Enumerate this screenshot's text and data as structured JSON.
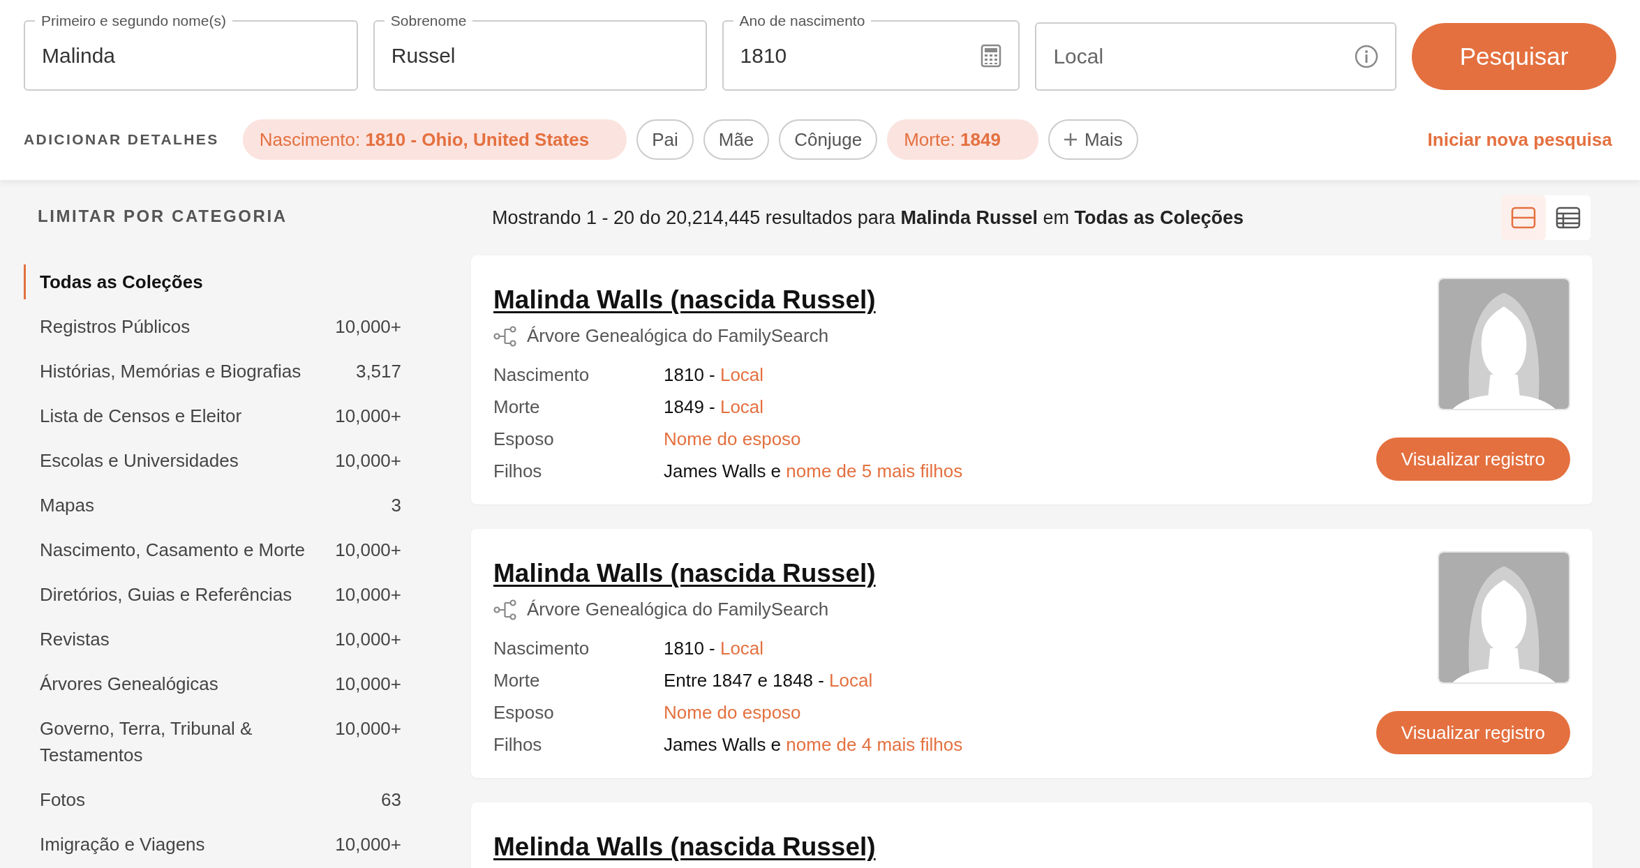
{
  "search": {
    "fields": [
      {
        "kind": "text",
        "label": "Primeiro e segundo nome(s)",
        "value": "Malinda"
      },
      {
        "kind": "text",
        "label": "Sobrenome",
        "value": "Russel"
      },
      {
        "kind": "date",
        "label": "Ano de nascimento",
        "value": "1810"
      },
      {
        "kind": "place",
        "placeholder": "Local"
      }
    ],
    "button": "Pesquisar"
  },
  "details": {
    "label": "ADICIONAR DETALHES",
    "chips": [
      {
        "kind": "filter",
        "text": "Nascimento: **1810 - Ohio, United States**",
        "active": true
      },
      {
        "kind": "filter",
        "text": "Pai",
        "active": false
      },
      {
        "kind": "filter",
        "text": "Mãe",
        "active": false
      },
      {
        "kind": "filter",
        "text": "Cônjuge",
        "active": false
      },
      {
        "kind": "filter",
        "text": "Morte: **1849**",
        "active": true
      },
      {
        "kind": "add",
        "text": "Mais",
        "active": false
      }
    ],
    "new_search": "Iniciar nova pesquisa"
  },
  "sidebar": {
    "heading": "LIMITAR POR CATEGORIA",
    "items": [
      {
        "label": "Todas as Coleções",
        "selected": true
      },
      {
        "label": "Registros Públicos",
        "count": "10,000+",
        "selected": false
      },
      {
        "label": "Histórias, Memórias e Biografias",
        "count": "3,517",
        "selected": false
      },
      {
        "label": "Lista de Censos e Eleitor",
        "count": "10,000+",
        "selected": false
      },
      {
        "label": "Escolas e Universidades",
        "count": "10,000+",
        "selected": false
      },
      {
        "label": "Mapas",
        "count": "3",
        "selected": false
      },
      {
        "label": "Nascimento, Casamento e Morte",
        "count": "10,000+",
        "selected": false
      },
      {
        "label": "Diretórios, Guias e Referências",
        "count": "10,000+",
        "selected": false
      },
      {
        "label": "Revistas",
        "count": "10,000+",
        "selected": false
      },
      {
        "label": "Árvores Genealógicas",
        "count": "10,000+",
        "selected": false
      },
      {
        "label": "Governo, Terra, Tribunal & Testamentos",
        "count": "10,000+",
        "selected": false
      },
      {
        "label": "Fotos",
        "count": "63",
        "selected": false
      },
      {
        "label": "Imigração e Viagens",
        "count": "10,000+",
        "selected": false
      }
    ]
  },
  "results": {
    "summary": "Mostrando 1 - 20 do 20,214,445 resultados para **Malinda Russel** em **Todas as Coleções**",
    "views": [
      {
        "kind": "list",
        "selected": true
      },
      {
        "kind": "table",
        "selected": false
      }
    ],
    "records": [
      {
        "name": "Malinda Walls (nascida Russel)",
        "source": "Árvore Genealógica do FamilySearch",
        "facts": [
          {
            "label": "Nascimento",
            "parts": [
              {
                "text": "1810 - ",
                "link": false
              },
              {
                "text": "Local",
                "link": true
              }
            ]
          },
          {
            "label": "Morte",
            "parts": [
              {
                "text": "1849 - ",
                "link": false
              },
              {
                "text": "Local",
                "link": true
              }
            ]
          },
          {
            "label": "Esposo",
            "parts": [
              {
                "text": "Nome do esposo",
                "link": true
              }
            ]
          },
          {
            "label": "Filhos",
            "parts": [
              {
                "text": "James Walls e ",
                "link": false
              },
              {
                "text": "nome de 5 mais filhos",
                "link": true
              }
            ]
          }
        ],
        "button": "Visualizar registro"
      },
      {
        "name": "Malinda Walls (nascida Russel)",
        "source": "Árvore Genealógica do FamilySearch",
        "facts": [
          {
            "label": "Nascimento",
            "parts": [
              {
                "text": "1810 - ",
                "link": false
              },
              {
                "text": "Local",
                "link": true
              }
            ]
          },
          {
            "label": "Morte",
            "parts": [
              {
                "text": "Entre 1847 e 1848 - ",
                "link": false
              },
              {
                "text": "Local",
                "link": true
              }
            ]
          },
          {
            "label": "Esposo",
            "parts": [
              {
                "text": "Nome do esposo",
                "link": true
              }
            ]
          },
          {
            "label": "Filhos",
            "parts": [
              {
                "text": "James Walls e ",
                "link": false
              },
              {
                "text": "nome de 4 mais filhos",
                "link": true
              }
            ]
          }
        ],
        "button": "Visualizar registro"
      },
      {
        "name": "Melinda Walls (nascida Russel)"
      }
    ]
  }
}
